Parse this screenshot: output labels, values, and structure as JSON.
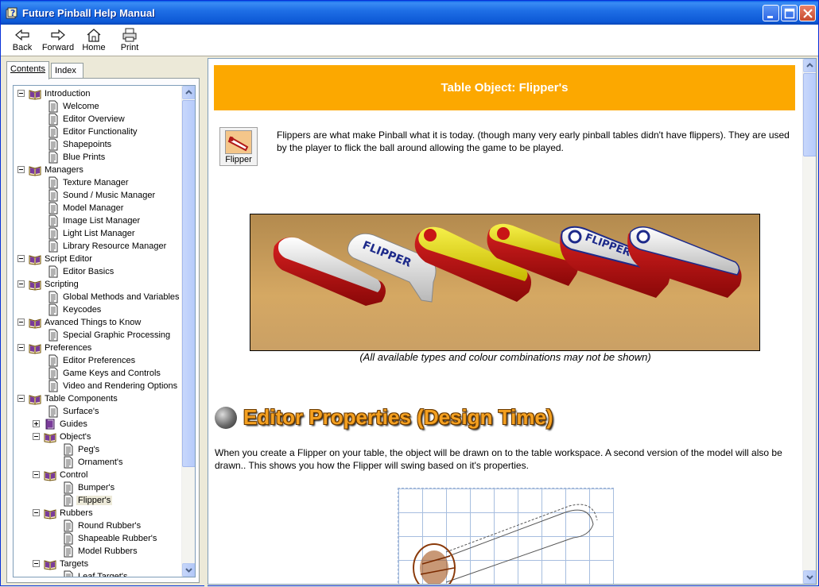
{
  "window": {
    "title": "Future Pinball Help Manual"
  },
  "toolbar": {
    "back": "Back",
    "forward": "Forward",
    "home": "Home",
    "print": "Print"
  },
  "tabs": {
    "contents": "Contents",
    "index": "Index"
  },
  "tree": [
    {
      "label": "Introduction",
      "kind": "book-open",
      "toggle": "minus",
      "indent": 0
    },
    {
      "label": "Welcome",
      "kind": "page",
      "indent": 1
    },
    {
      "label": "Editor Overview",
      "kind": "page",
      "indent": 1
    },
    {
      "label": "Editor Functionality",
      "kind": "page",
      "indent": 1
    },
    {
      "label": "Shapepoints",
      "kind": "page",
      "indent": 1
    },
    {
      "label": "Blue Prints",
      "kind": "page",
      "indent": 1
    },
    {
      "label": "Managers",
      "kind": "book-open",
      "toggle": "minus",
      "indent": 0
    },
    {
      "label": "Texture Manager",
      "kind": "page",
      "indent": 1
    },
    {
      "label": "Sound / Music Manager",
      "kind": "page",
      "indent": 1
    },
    {
      "label": "Model Manager",
      "kind": "page",
      "indent": 1
    },
    {
      "label": "Image List Manager",
      "kind": "page",
      "indent": 1
    },
    {
      "label": "Light List Manager",
      "kind": "page",
      "indent": 1
    },
    {
      "label": "Library Resource Manager",
      "kind": "page",
      "indent": 1
    },
    {
      "label": "Script Editor",
      "kind": "book-open",
      "toggle": "minus",
      "indent": 0
    },
    {
      "label": "Editor Basics",
      "kind": "page",
      "indent": 1
    },
    {
      "label": "Scripting",
      "kind": "book-open",
      "toggle": "minus",
      "indent": 0
    },
    {
      "label": "Global Methods and Variables",
      "kind": "page",
      "indent": 1
    },
    {
      "label": "Keycodes",
      "kind": "page",
      "indent": 1
    },
    {
      "label": "Avanced Things to Know",
      "kind": "book-open",
      "toggle": "minus",
      "indent": 0
    },
    {
      "label": "Special Graphic Processing",
      "kind": "page",
      "indent": 1
    },
    {
      "label": "Preferences",
      "kind": "book-open",
      "toggle": "minus",
      "indent": 0
    },
    {
      "label": "Editor Preferences",
      "kind": "page",
      "indent": 1
    },
    {
      "label": "Game Keys and Controls",
      "kind": "page",
      "indent": 1
    },
    {
      "label": "Video and Rendering Options",
      "kind": "page",
      "indent": 1
    },
    {
      "label": "Table Components",
      "kind": "book-open",
      "toggle": "minus",
      "indent": 0
    },
    {
      "label": "Surface's",
      "kind": "page",
      "indent": 1
    },
    {
      "label": "Guides",
      "kind": "book-closed",
      "toggle": "plus",
      "indent": 1
    },
    {
      "label": "Object's",
      "kind": "book-open",
      "toggle": "minus",
      "indent": 1
    },
    {
      "label": "Peg's",
      "kind": "page",
      "indent": 2
    },
    {
      "label": "Ornament's",
      "kind": "page",
      "indent": 2
    },
    {
      "label": "Control",
      "kind": "book-open",
      "toggle": "minus",
      "indent": 1
    },
    {
      "label": "Bumper's",
      "kind": "page",
      "indent": 2
    },
    {
      "label": "Flipper's",
      "kind": "page",
      "indent": 2,
      "selected": true
    },
    {
      "label": "Rubbers",
      "kind": "book-open",
      "toggle": "minus",
      "indent": 1
    },
    {
      "label": "Round Rubber's",
      "kind": "page",
      "indent": 2
    },
    {
      "label": "Shapeable Rubber's",
      "kind": "page",
      "indent": 2
    },
    {
      "label": "Model Rubbers",
      "kind": "page",
      "indent": 2
    },
    {
      "label": "Targets",
      "kind": "book-open",
      "toggle": "minus",
      "indent": 1
    },
    {
      "label": "Leaf Target's",
      "kind": "page",
      "indent": 2
    }
  ],
  "page": {
    "banner": "Table Object: Flipper's",
    "icon_caption": "Flipper",
    "intro": "Flippers are what make Pinball what it is today. (though many very early pinball tables didn't have flippers). They are used by the player to flick the ball around allowing the game to be played.",
    "photo_word": "FLIPPER",
    "caption": "(All available types and colour combinations may not be shown)",
    "section_heading": "Editor Properties (Design Time)",
    "section_text": "When you create a Flipper on your table, the object will be drawn on to the table workspace. A second version of the model will also be drawn.. This shows you how the Flipper will swing based on it's properties."
  },
  "colors": {
    "banner": "#fca800",
    "heading": "#f4a020",
    "titlebar": "#0a5fe8"
  }
}
